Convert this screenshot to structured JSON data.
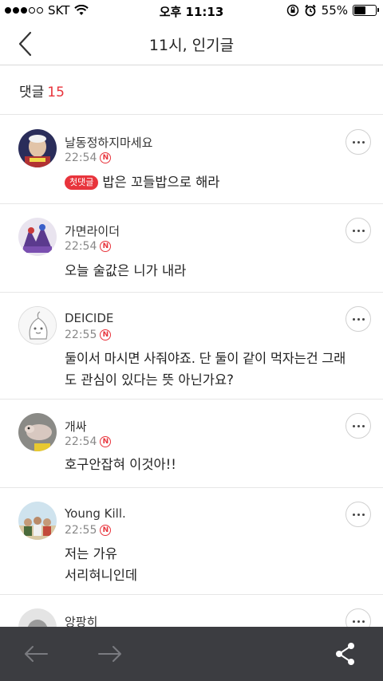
{
  "status_bar": {
    "carrier": "SKT",
    "time": "오후 11:13",
    "battery": "55%",
    "battery_level": 0.55,
    "signal_bars_filled": 3,
    "signal_bars_total": 5
  },
  "nav": {
    "title": "11시, 인기글",
    "back_icon": "chevron-left-icon"
  },
  "comments_header": {
    "label": "댓글",
    "count": "15"
  },
  "comments": [
    {
      "author": "날동정하지마세요",
      "time": "22:54",
      "badge": "N",
      "tag": "첫댓글",
      "text": "밥은 꼬들밥으로 해라"
    },
    {
      "author": "가면라이더",
      "time": "22:54",
      "badge": "N",
      "text": "오늘 술값은 니가 내라"
    },
    {
      "author": "DEICIDE",
      "time": "22:55",
      "badge": "N",
      "text_line1": "둘이서 마시면 사줘야죠. 단 둘이 같이 먹자는건 그래",
      "text_line2": "도 관심이 있다는 뜻 아닌가요?"
    },
    {
      "author": "개싸",
      "time": "22:54",
      "badge": "N",
      "text": "호구안잡혀 이것아!!"
    },
    {
      "author": "Young Kill.",
      "time": "22:55",
      "badge": "N",
      "text_line1": "저는 가유",
      "text_line2": "서리혀니인데"
    },
    {
      "author": "앙팡히"
    }
  ],
  "toolbar": {
    "back_icon": "arrow-left-icon",
    "forward_icon": "arrow-right-icon",
    "share_icon": "share-icon"
  },
  "colors": {
    "accent": "#e8343c",
    "toolbar_bg": "#3c3d41",
    "divider": "#e6e6e6"
  }
}
